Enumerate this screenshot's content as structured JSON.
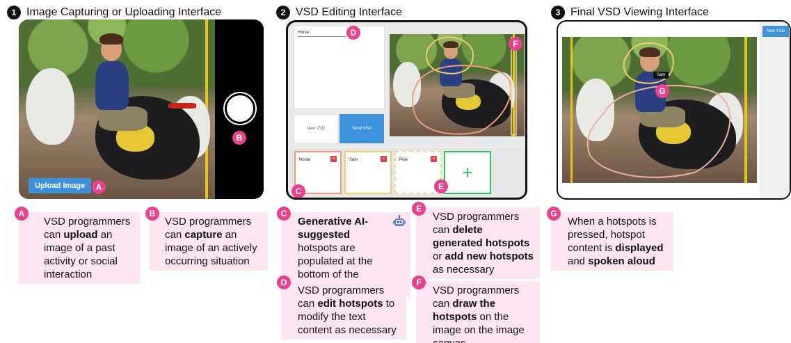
{
  "sections": [
    {
      "num": "1",
      "title": "Image Capturing or Uploading Interface"
    },
    {
      "num": "2",
      "title": "VSD Editing Interface"
    },
    {
      "num": "3",
      "title": "Final VSD Viewing Interface"
    }
  ],
  "panel1": {
    "upload_label": "Upload Image",
    "marker_a": "A",
    "marker_b": "B"
  },
  "panel2": {
    "edit_card_text": "Horse",
    "marker_d": "D",
    "marker_f": "F",
    "new_vsd": "New VSD",
    "send_vsd": "Send VSD",
    "hotspots": [
      {
        "label": "Horse",
        "color": "#f19a7c"
      },
      {
        "label": "Sam",
        "color": "#f2cc6e"
      },
      {
        "label": "Pole",
        "color": "#e9e19a"
      }
    ],
    "add_symbol": "+",
    "marker_c": "C",
    "marker_e": "E"
  },
  "panel3": {
    "new_vsd": "New VSD",
    "tooltip": "Sam",
    "marker_g": "G"
  },
  "notes": {
    "a": {
      "marker": "A",
      "t1": "VSD programmers can ",
      "b1": "upload",
      "t2": " an image of a past activity or social interaction"
    },
    "b": {
      "marker": "B",
      "t1": "VSD programmers can ",
      "b1": "capture",
      "t2": " an image of an actively occurring situation"
    },
    "c": {
      "marker": "C",
      "b1": "Generative AI-suggested",
      "t1": " hotspots are populated at the bottom of the screen"
    },
    "d": {
      "marker": "D",
      "t1": "VSD programmers can ",
      "b1": "edit hotspots",
      "t2": " to modify the text content as necessary"
    },
    "e": {
      "marker": "E",
      "t1": "VSD programmers can ",
      "b1": "delete generated hotspots",
      "t2": " or ",
      "b2": "add new hotspots",
      "t3": " as necessary"
    },
    "f": {
      "marker": "F",
      "t1": "VSD programmers can ",
      "b1": "draw the hotspots",
      "t2": " on the image on the image canvas"
    },
    "g": {
      "marker": "G",
      "t1": "When a hotspots is pressed, hotspot content is ",
      "b1": "displayed",
      "t2": " and ",
      "b2": "spoken aloud"
    }
  },
  "colors": {
    "accent_pink": "#e9418b",
    "note_bg": "#fde6f2",
    "button_blue": "#3d8fd9",
    "add_green": "#2ec35a"
  }
}
